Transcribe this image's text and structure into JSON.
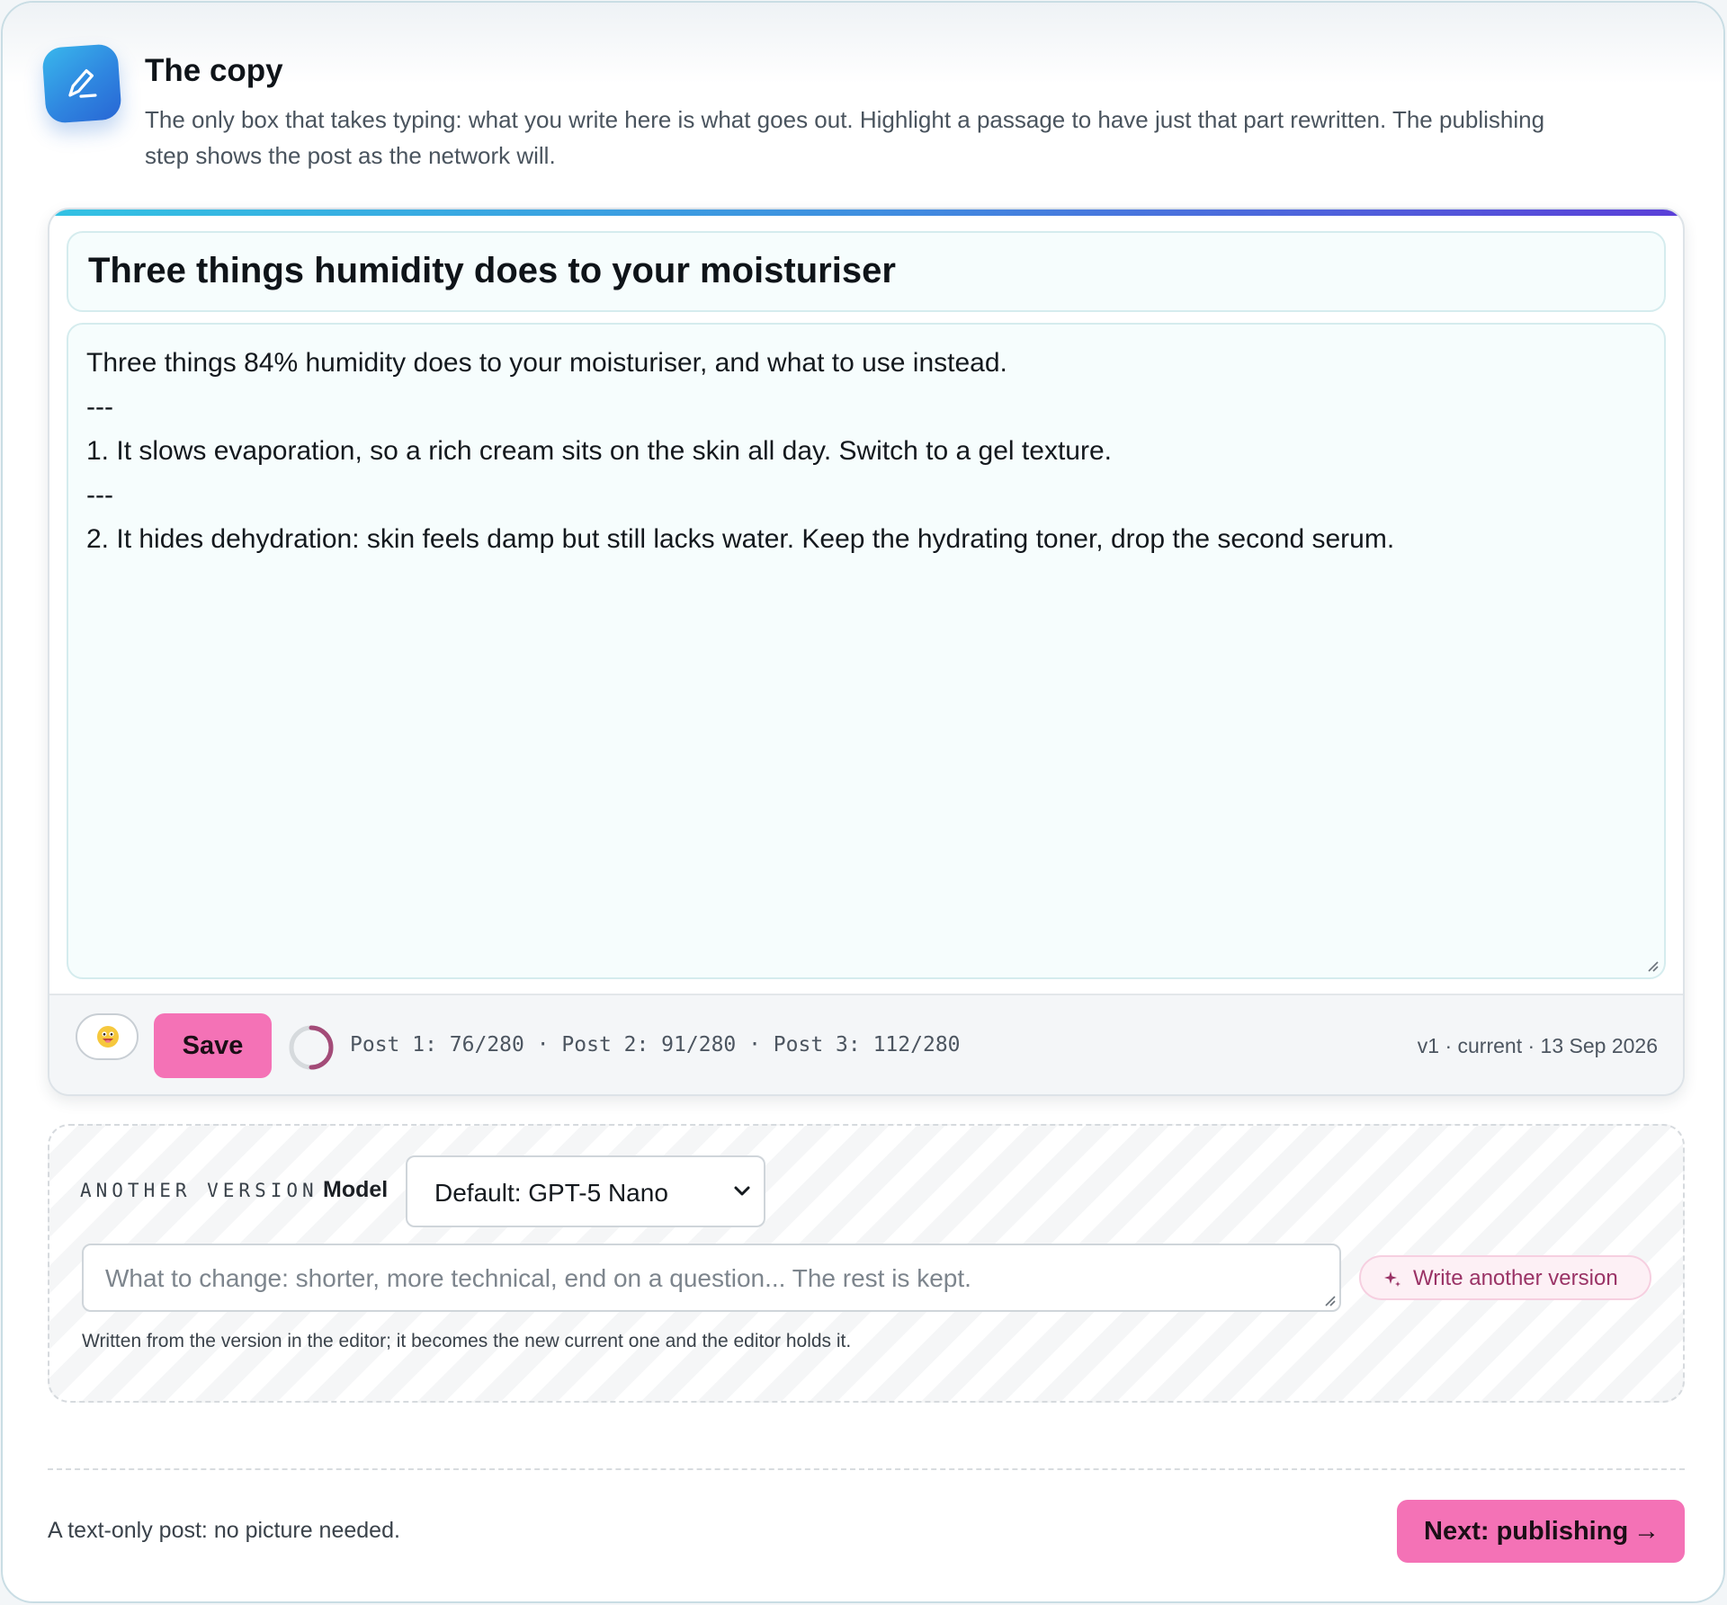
{
  "header": {
    "title": "The copy",
    "subtitle": "The only box that takes typing: what you write here is what goes out. Highlight a passage to have just that part rewritten. The publishing step shows the post as the network will.",
    "icon": "pen-icon"
  },
  "editor": {
    "headline": "Three things humidity does to your moisturiser",
    "body_lines": [
      "Three things 84% humidity does to your moisturiser, and what to use instead.",
      "---",
      "1. It slows evaporation, so a rich cream sits on the skin all day. Switch to a gel texture.",
      "---",
      "2. It hides dehydration: skin feels damp but still lacks water. Keep the hydrating toner, drop the second serum."
    ],
    "toolbar": {
      "emoji_icon": "emoji-icon",
      "save_label": "Save",
      "counts": "Post 1: 76/280 · Post 2: 91/280 · Post 3: 112/280",
      "version_meta": "v1 · current · 13 Sep 2026"
    },
    "accent_gradient": [
      "#33c2e3",
      "#3f8fe0",
      "#5b3fd8"
    ]
  },
  "another_version": {
    "label": "ANOTHER VERSION",
    "model_label": "Model",
    "model_selected": "Default: GPT-5 Nano",
    "change_placeholder": "What to change: shorter, more technical, end on a question... The rest is kept.",
    "write_label": "Write another version",
    "write_icon": "sparkle-icon",
    "note": "Written from the version in the editor; it becomes the new current one and the editor holds it."
  },
  "footer": {
    "note": "A text-only post: no picture needed.",
    "next_label": "Next: publishing",
    "next_arrow": "→"
  },
  "colors": {
    "primary_pink": "#f472b6",
    "icon_blue": "#2f86e0",
    "text_muted": "#4a545e"
  }
}
